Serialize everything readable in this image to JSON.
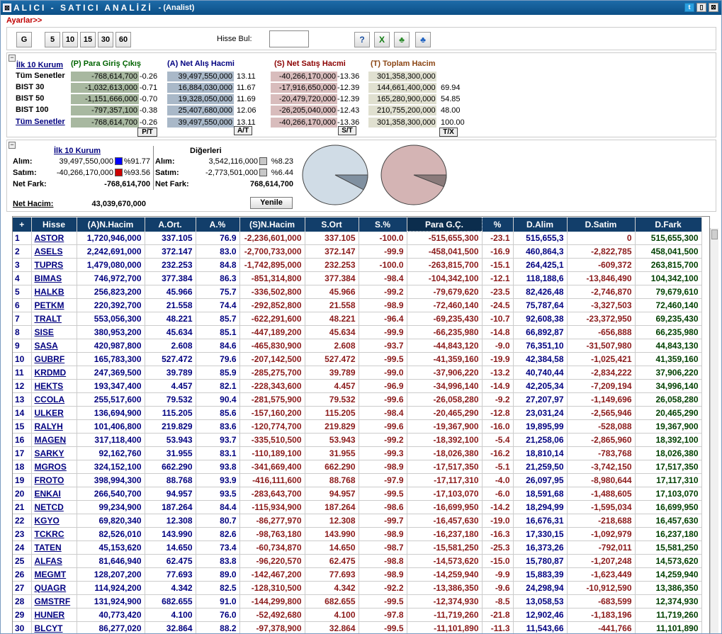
{
  "window": {
    "title": "ALICI - SATICI ANALİZİ",
    "subtitle": "- (Analist)"
  },
  "menu": {
    "settings": "Ayarlar>>"
  },
  "toolbar": {
    "buttons": [
      "G",
      "5",
      "10",
      "15",
      "30",
      "60"
    ],
    "search_label": "Hisse Bul:",
    "search_value": "",
    "icons": [
      "help-icon",
      "excel-icon",
      "group-green-icon",
      "group-blue-icon"
    ]
  },
  "summary": {
    "top_label": "İlk 10 Kurum",
    "headers": {
      "p": "(P) Para Giriş Çıkış",
      "a": "(A) Net Alış Hacmi",
      "s": "(S) Net Satış Hacmi",
      "t": "(T) Toplam Hacim"
    },
    "rows": [
      {
        "label": "Tüm Senetler",
        "p": "-768,614,700",
        "pp": "-0.26",
        "a": "39,497,550,000",
        "ap": "13.11",
        "s": "-40,266,170,000",
        "sp": "-13.36",
        "t": "301,358,300,000",
        "tp": ""
      },
      {
        "label": "BIST 30",
        "p": "-1,032,613,000",
        "pp": "-0.71",
        "a": "16,884,030,000",
        "ap": "11.67",
        "s": "-17,916,650,000",
        "sp": "-12.39",
        "t": "144,661,400,000",
        "tp": "69.94"
      },
      {
        "label": "BIST 50",
        "p": "-1,151,666,000",
        "pp": "-0.70",
        "a": "19,328,050,000",
        "ap": "11.69",
        "s": "-20,479,720,000",
        "sp": "-12.39",
        "t": "165,280,900,000",
        "tp": "54.85"
      },
      {
        "label": "BIST 100",
        "p": "-797,357,100",
        "pp": "-0.38",
        "a": "25,407,680,000",
        "ap": "12.06",
        "s": "-26,205,040,000",
        "sp": "-12.43",
        "t": "210,755,200,000",
        "tp": "48.00"
      },
      {
        "label": "Tüm Senetler",
        "p": "-768,614,700",
        "pp": "-0.26",
        "a": "39,497,550,000",
        "ap": "13.11",
        "s": "-40,266,170,000",
        "sp": "-13.36",
        "t": "301,358,300,000",
        "tp": "100.00"
      }
    ],
    "ratio_buttons": [
      "P/T",
      "A/T",
      "S/T",
      "T/X"
    ]
  },
  "breakdown": {
    "top_label": "İlk 10 Kurum",
    "other_label": "Diğerleri",
    "alim_label": "Alım:",
    "satim_label": "Satım:",
    "netfark_label": "Net Fark:",
    "top_alim": "39,497,550,000",
    "top_alim_pct": "%91.77",
    "top_satim": "-40,266,170,000",
    "top_satim_pct": "%93.56",
    "top_netfark": "-768,614,700",
    "other_alim": "3,542,116,000",
    "other_alim_pct": "%8.23",
    "other_satim": "-2,773,501,000",
    "other_satim_pct": "%6.44",
    "other_netfark": "768,614,700",
    "net_hacim_label": "Net Hacim:",
    "net_hacim": "43,039,670,000",
    "refresh": "Yenile",
    "pie_alim_share": 0.9177,
    "pie_satim_share": 0.9356,
    "colors": {
      "alim": "#0000ff",
      "satim": "#cc0000",
      "other": "#c8c8c8"
    }
  },
  "grid": {
    "columns": [
      "+",
      "Hisse",
      "(A)N.Hacim",
      "A.Ort.",
      "A.%",
      "(S)N.Hacim",
      "S.Ort",
      "S.%",
      "Para G.Ç.",
      "%",
      "D.Alim",
      "D.Satim",
      "D.Fark"
    ],
    "rows": [
      [
        "1",
        "ASTOR",
        "1,720,946,000",
        "337.105",
        "76.9",
        "-2,236,601,000",
        "337.105",
        "-100.0",
        "-515,655,300",
        "-23.1",
        "515,655,3",
        "0",
        "515,655,300"
      ],
      [
        "2",
        "ASELS",
        "2,242,691,000",
        "372.147",
        "83.0",
        "-2,700,733,000",
        "372.147",
        "-99.9",
        "-458,041,500",
        "-16.9",
        "460,864,3",
        "-2,822,785",
        "458,041,500"
      ],
      [
        "3",
        "TUPRS",
        "1,479,080,000",
        "232.253",
        "84.8",
        "-1,742,895,000",
        "232.253",
        "-100.0",
        "-263,815,700",
        "-15.1",
        "264,425,1",
        "-609,372",
        "263,815,700"
      ],
      [
        "4",
        "BIMAS",
        "746,972,700",
        "377.384",
        "86.3",
        "-851,314,800",
        "377.384",
        "-98.4",
        "-104,342,100",
        "-12.1",
        "118,188,6",
        "-13,846,490",
        "104,342,100"
      ],
      [
        "5",
        "HALKB",
        "256,823,200",
        "45.966",
        "75.7",
        "-336,502,800",
        "45.966",
        "-99.2",
        "-79,679,620",
        "-23.5",
        "82,426,48",
        "-2,746,870",
        "79,679,610"
      ],
      [
        "6",
        "PETKM",
        "220,392,700",
        "21.558",
        "74.4",
        "-292,852,800",
        "21.558",
        "-98.9",
        "-72,460,140",
        "-24.5",
        "75,787,64",
        "-3,327,503",
        "72,460,140"
      ],
      [
        "7",
        "TRALT",
        "553,056,300",
        "48.221",
        "85.7",
        "-622,291,600",
        "48.221",
        "-96.4",
        "-69,235,430",
        "-10.7",
        "92,608,38",
        "-23,372,950",
        "69,235,430"
      ],
      [
        "8",
        "SISE",
        "380,953,200",
        "45.634",
        "85.1",
        "-447,189,200",
        "45.634",
        "-99.9",
        "-66,235,980",
        "-14.8",
        "66,892,87",
        "-656,888",
        "66,235,980"
      ],
      [
        "9",
        "SASA",
        "420,987,800",
        "2.608",
        "84.6",
        "-465,830,900",
        "2.608",
        "-93.7",
        "-44,843,120",
        "-9.0",
        "76,351,10",
        "-31,507,980",
        "44,843,130"
      ],
      [
        "10",
        "GUBRF",
        "165,783,300",
        "527.472",
        "79.6",
        "-207,142,500",
        "527.472",
        "-99.5",
        "-41,359,160",
        "-19.9",
        "42,384,58",
        "-1,025,421",
        "41,359,160"
      ],
      [
        "11",
        "KRDMD",
        "247,369,500",
        "39.789",
        "85.9",
        "-285,275,700",
        "39.789",
        "-99.0",
        "-37,906,220",
        "-13.2",
        "40,740,44",
        "-2,834,222",
        "37,906,220"
      ],
      [
        "12",
        "HEKTS",
        "193,347,400",
        "4.457",
        "82.1",
        "-228,343,600",
        "4.457",
        "-96.9",
        "-34,996,140",
        "-14.9",
        "42,205,34",
        "-7,209,194",
        "34,996,140"
      ],
      [
        "13",
        "CCOLA",
        "255,517,600",
        "79.532",
        "90.4",
        "-281,575,900",
        "79.532",
        "-99.6",
        "-26,058,280",
        "-9.2",
        "27,207,97",
        "-1,149,696",
        "26,058,280"
      ],
      [
        "14",
        "ULKER",
        "136,694,900",
        "115.205",
        "85.6",
        "-157,160,200",
        "115.205",
        "-98.4",
        "-20,465,290",
        "-12.8",
        "23,031,24",
        "-2,565,946",
        "20,465,290"
      ],
      [
        "15",
        "RALYH",
        "101,406,800",
        "219.829",
        "83.6",
        "-120,774,700",
        "219.829",
        "-99.6",
        "-19,367,900",
        "-16.0",
        "19,895,99",
        "-528,088",
        "19,367,900"
      ],
      [
        "16",
        "MAGEN",
        "317,118,400",
        "53.943",
        "93.7",
        "-335,510,500",
        "53.943",
        "-99.2",
        "-18,392,100",
        "-5.4",
        "21,258,06",
        "-2,865,960",
        "18,392,100"
      ],
      [
        "17",
        "SARKY",
        "92,162,760",
        "31.955",
        "83.1",
        "-110,189,100",
        "31.955",
        "-99.3",
        "-18,026,380",
        "-16.2",
        "18,810,14",
        "-783,768",
        "18,026,380"
      ],
      [
        "18",
        "MGROS",
        "324,152,100",
        "662.290",
        "93.8",
        "-341,669,400",
        "662.290",
        "-98.9",
        "-17,517,350",
        "-5.1",
        "21,259,50",
        "-3,742,150",
        "17,517,350"
      ],
      [
        "19",
        "FROTO",
        "398,994,300",
        "88.768",
        "93.9",
        "-416,111,600",
        "88.768",
        "-97.9",
        "-17,117,310",
        "-4.0",
        "26,097,95",
        "-8,980,644",
        "17,117,310"
      ],
      [
        "20",
        "ENKAI",
        "266,540,700",
        "94.957",
        "93.5",
        "-283,643,700",
        "94.957",
        "-99.5",
        "-17,103,070",
        "-6.0",
        "18,591,68",
        "-1,488,605",
        "17,103,070"
      ],
      [
        "21",
        "NETCD",
        "99,234,900",
        "187.264",
        "84.4",
        "-115,934,900",
        "187.264",
        "-98.6",
        "-16,699,950",
        "-14.2",
        "18,294,99",
        "-1,595,034",
        "16,699,950"
      ],
      [
        "22",
        "KGYO",
        "69,820,340",
        "12.308",
        "80.7",
        "-86,277,970",
        "12.308",
        "-99.7",
        "-16,457,630",
        "-19.0",
        "16,676,31",
        "-218,688",
        "16,457,630"
      ],
      [
        "23",
        "TCKRC",
        "82,526,010",
        "143.990",
        "82.6",
        "-98,763,180",
        "143.990",
        "-98.9",
        "-16,237,180",
        "-16.3",
        "17,330,15",
        "-1,092,979",
        "16,237,180"
      ],
      [
        "24",
        "TATEN",
        "45,153,620",
        "14.650",
        "73.4",
        "-60,734,870",
        "14.650",
        "-98.7",
        "-15,581,250",
        "-25.3",
        "16,373,26",
        "-792,011",
        "15,581,250"
      ],
      [
        "25",
        "ALFAS",
        "81,646,940",
        "62.475",
        "83.8",
        "-96,220,570",
        "62.475",
        "-98.8",
        "-14,573,620",
        "-15.0",
        "15,780,87",
        "-1,207,248",
        "14,573,620"
      ],
      [
        "26",
        "MEGMT",
        "128,207,200",
        "77.693",
        "89.0",
        "-142,467,200",
        "77.693",
        "-98.9",
        "-14,259,940",
        "-9.9",
        "15,883,39",
        "-1,623,449",
        "14,259,940"
      ],
      [
        "27",
        "QUAGR",
        "114,924,200",
        "4.342",
        "82.5",
        "-128,310,500",
        "4.342",
        "-92.2",
        "-13,386,350",
        "-9.6",
        "24,298,94",
        "-10,912,590",
        "13,386,350"
      ],
      [
        "28",
        "GMSTRF",
        "131,924,900",
        "682.655",
        "91.0",
        "-144,299,800",
        "682.655",
        "-99.5",
        "-12,374,930",
        "-8.5",
        "13,058,53",
        "-683,599",
        "12,374,930"
      ],
      [
        "29",
        "HUNER",
        "40,773,420",
        "4.100",
        "76.0",
        "-52,492,680",
        "4.100",
        "-97.8",
        "-11,719,260",
        "-21.8",
        "12,902,46",
        "-1,183,196",
        "11,719,260"
      ],
      [
        "30",
        "BLCYT",
        "86,277,020",
        "32.864",
        "88.2",
        "-97,378,900",
        "32.864",
        "-99.5",
        "-11,101,890",
        "-11.3",
        "11,543,66",
        "-441,766",
        "11,101,890"
      ]
    ]
  }
}
